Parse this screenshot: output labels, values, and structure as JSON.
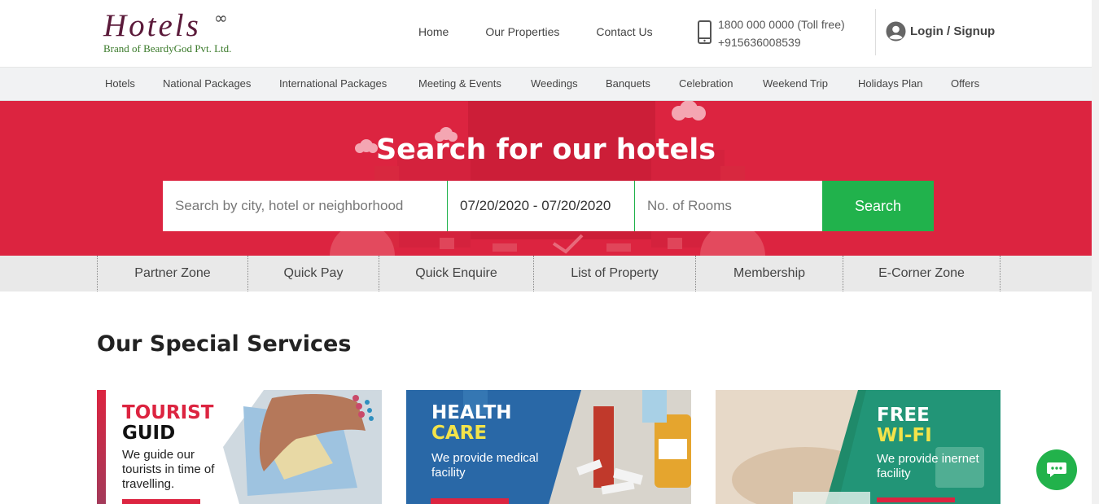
{
  "header": {
    "logo_title": "Hotels",
    "logo_mark": "∞",
    "logo_subtitle": "Brand of BeardyGod Pvt. Ltd.",
    "nav": [
      "Home",
      "Our Properties",
      "Contact Us"
    ],
    "phone_primary": "1800 000 0000 (Toll free)",
    "phone_secondary": "+915636008539",
    "login_label": "Login / Signup"
  },
  "category_nav": [
    "Hotels",
    "National Packages",
    "International Packages",
    "Meeting & Events",
    "Weedings",
    "Banquets",
    "Celebration",
    "Weekend Trip",
    "Holidays Plan",
    "Offers"
  ],
  "hero": {
    "title": "Search for our hotels",
    "search_placeholder": "Search by city, hotel or neighborhood",
    "date_range": "07/20/2020 - 07/20/2020",
    "rooms_placeholder": "No. of Rooms",
    "search_button": "Search"
  },
  "quick_links": [
    "Partner Zone",
    "Quick Pay",
    "Quick Enquire",
    "List of Property",
    "Membership",
    "E-Corner Zone"
  ],
  "services": {
    "title": "Our Special Services",
    "cards": [
      {
        "line1": "TOURIST",
        "line2": "GUID",
        "desc": "We guide our tourists in time of travelling."
      },
      {
        "line1": "HEALTH",
        "line2": "CARE",
        "desc": "We provide medical facility"
      },
      {
        "line1": "FREE",
        "line2": "WI-FI",
        "desc": "We provide inernet facility"
      }
    ]
  },
  "colors": {
    "brand_red": "#dc2440",
    "brand_green": "#21b24c",
    "highlight_yellow": "#f3e34a"
  }
}
